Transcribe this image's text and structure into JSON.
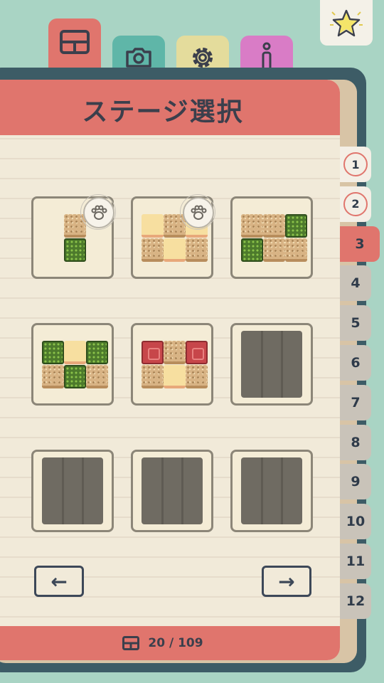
{
  "header": {
    "title": "ステージ選択"
  },
  "tabs": [
    {
      "name": "stages",
      "icon": "stage-book-icon",
      "color": "#e0756d"
    },
    {
      "name": "camera",
      "icon": "camera-icon",
      "color": "#5fb6a8"
    },
    {
      "name": "settings",
      "icon": "gear-icon",
      "color": "#e4dc9c"
    },
    {
      "name": "info",
      "icon": "info-icon",
      "color": "#d97cc6"
    }
  ],
  "star_button": {
    "icon": "star-icon"
  },
  "chapters": [
    {
      "label": "1",
      "state": "completed"
    },
    {
      "label": "2",
      "state": "completed"
    },
    {
      "label": "3",
      "state": "current"
    },
    {
      "label": "4",
      "state": "locked"
    },
    {
      "label": "5",
      "state": "locked"
    },
    {
      "label": "6",
      "state": "locked"
    },
    {
      "label": "7",
      "state": "locked"
    },
    {
      "label": "8",
      "state": "locked"
    },
    {
      "label": "9",
      "state": "locked"
    },
    {
      "label": "10",
      "state": "locked"
    },
    {
      "label": "11",
      "state": "locked"
    },
    {
      "label": "12",
      "state": "locked"
    }
  ],
  "stages": [
    {
      "state": "cleared",
      "badge": "paw-icon"
    },
    {
      "state": "cleared",
      "badge": "paw-icon"
    },
    {
      "state": "unlocked"
    },
    {
      "state": "unlocked"
    },
    {
      "state": "unlocked"
    },
    {
      "state": "locked"
    },
    {
      "state": "locked"
    },
    {
      "state": "locked"
    },
    {
      "state": "locked"
    }
  ],
  "nav": {
    "prev": "←",
    "next": "→"
  },
  "footer": {
    "progress": "20 / 109",
    "icon": "stage-book-icon"
  },
  "colors": {
    "accent": "#e0756d",
    "background": "#a9d4c4",
    "frame": "#3d5c66"
  }
}
